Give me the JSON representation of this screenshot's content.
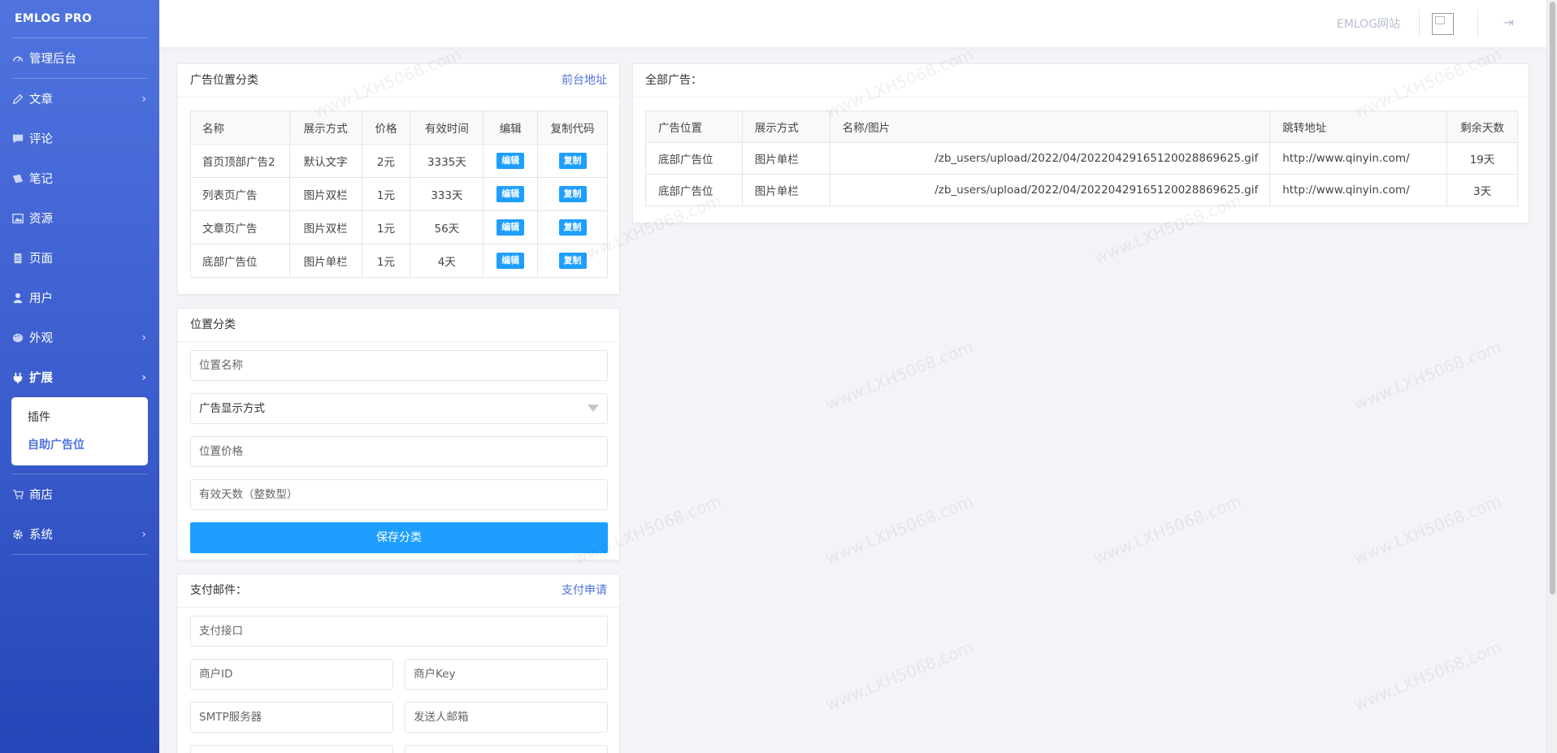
{
  "sidebar": {
    "brand": "EMLOG PRO",
    "items": [
      {
        "label": "管理后台",
        "icon": "dashboard-icon",
        "chev": false
      },
      {
        "label": "文章",
        "icon": "pencil-icon",
        "chev": true
      },
      {
        "label": "评论",
        "icon": "comment-icon",
        "chev": false
      },
      {
        "label": "笔记",
        "icon": "note-icon",
        "chev": false
      },
      {
        "label": "资源",
        "icon": "image-icon",
        "chev": false
      },
      {
        "label": "页面",
        "icon": "page-icon",
        "chev": false
      },
      {
        "label": "用户",
        "icon": "user-icon",
        "chev": false
      },
      {
        "label": "外观",
        "icon": "palette-icon",
        "chev": true
      },
      {
        "label": "扩展",
        "icon": "plug-icon",
        "chev": true
      },
      {
        "label": "商店",
        "icon": "cart-icon",
        "chev": false
      },
      {
        "label": "系统",
        "icon": "gear-icon",
        "chev": true
      }
    ],
    "submenu": [
      "插件",
      "自助广告位"
    ]
  },
  "topbar": {
    "site_link": "EMLOG网站",
    "logout_icon": "logout-icon",
    "avatar_icon": "broken-image-icon"
  },
  "ad_categories": {
    "title": "广告位置分类",
    "link": "前台地址",
    "headers": [
      "名称",
      "展示方式",
      "价格",
      "有效时间",
      "编辑",
      "复制代码"
    ],
    "rows": [
      {
        "name": "首页顶部广告2",
        "mode": "默认文字",
        "price": "2元",
        "time": "3335天",
        "edit": "编辑",
        "copy": "复制"
      },
      {
        "name": "列表页广告",
        "mode": "图片双栏",
        "price": "1元",
        "time": "333天",
        "edit": "编辑",
        "copy": "复制"
      },
      {
        "name": "文章页广告",
        "mode": "图片双栏",
        "price": "1元",
        "time": "56天",
        "edit": "编辑",
        "copy": "复制"
      },
      {
        "name": "底部广告位",
        "mode": "图片单栏",
        "price": "1元",
        "time": "4天",
        "edit": "编辑",
        "copy": "复制"
      }
    ]
  },
  "position_form": {
    "title": "位置分类",
    "name_placeholder": "位置名称",
    "mode_select": "广告显示方式",
    "price_placeholder": "位置价格",
    "days_placeholder": "有效天数（整数型）",
    "save": "保存分类"
  },
  "payment": {
    "title": "支付邮件：",
    "link": "支付申请",
    "api_placeholder": "支付接口",
    "merchant_id": "商户ID",
    "merchant_key": "商户Key",
    "smtp": "SMTP服务器",
    "sender": "发送人邮箱"
  },
  "all_ads": {
    "title": "全部广告：",
    "headers": [
      "广告位置",
      "展示方式",
      "名称/图片",
      "跳转地址",
      "剩余天数"
    ],
    "rows": [
      {
        "position": "底部广告位",
        "mode": "图片单栏",
        "path": "/zb_users/upload/2022/04/20220429165120028869625.gif",
        "url": "http://www.qinyin.com/",
        "days": "19天"
      },
      {
        "position": "底部广告位",
        "mode": "图片单栏",
        "path": "/zb_users/upload/2022/04/20220429165120028869625.gif",
        "url": "http://www.qinyin.com/",
        "days": "3天"
      }
    ]
  },
  "watermark": "www.LXH5068.com"
}
